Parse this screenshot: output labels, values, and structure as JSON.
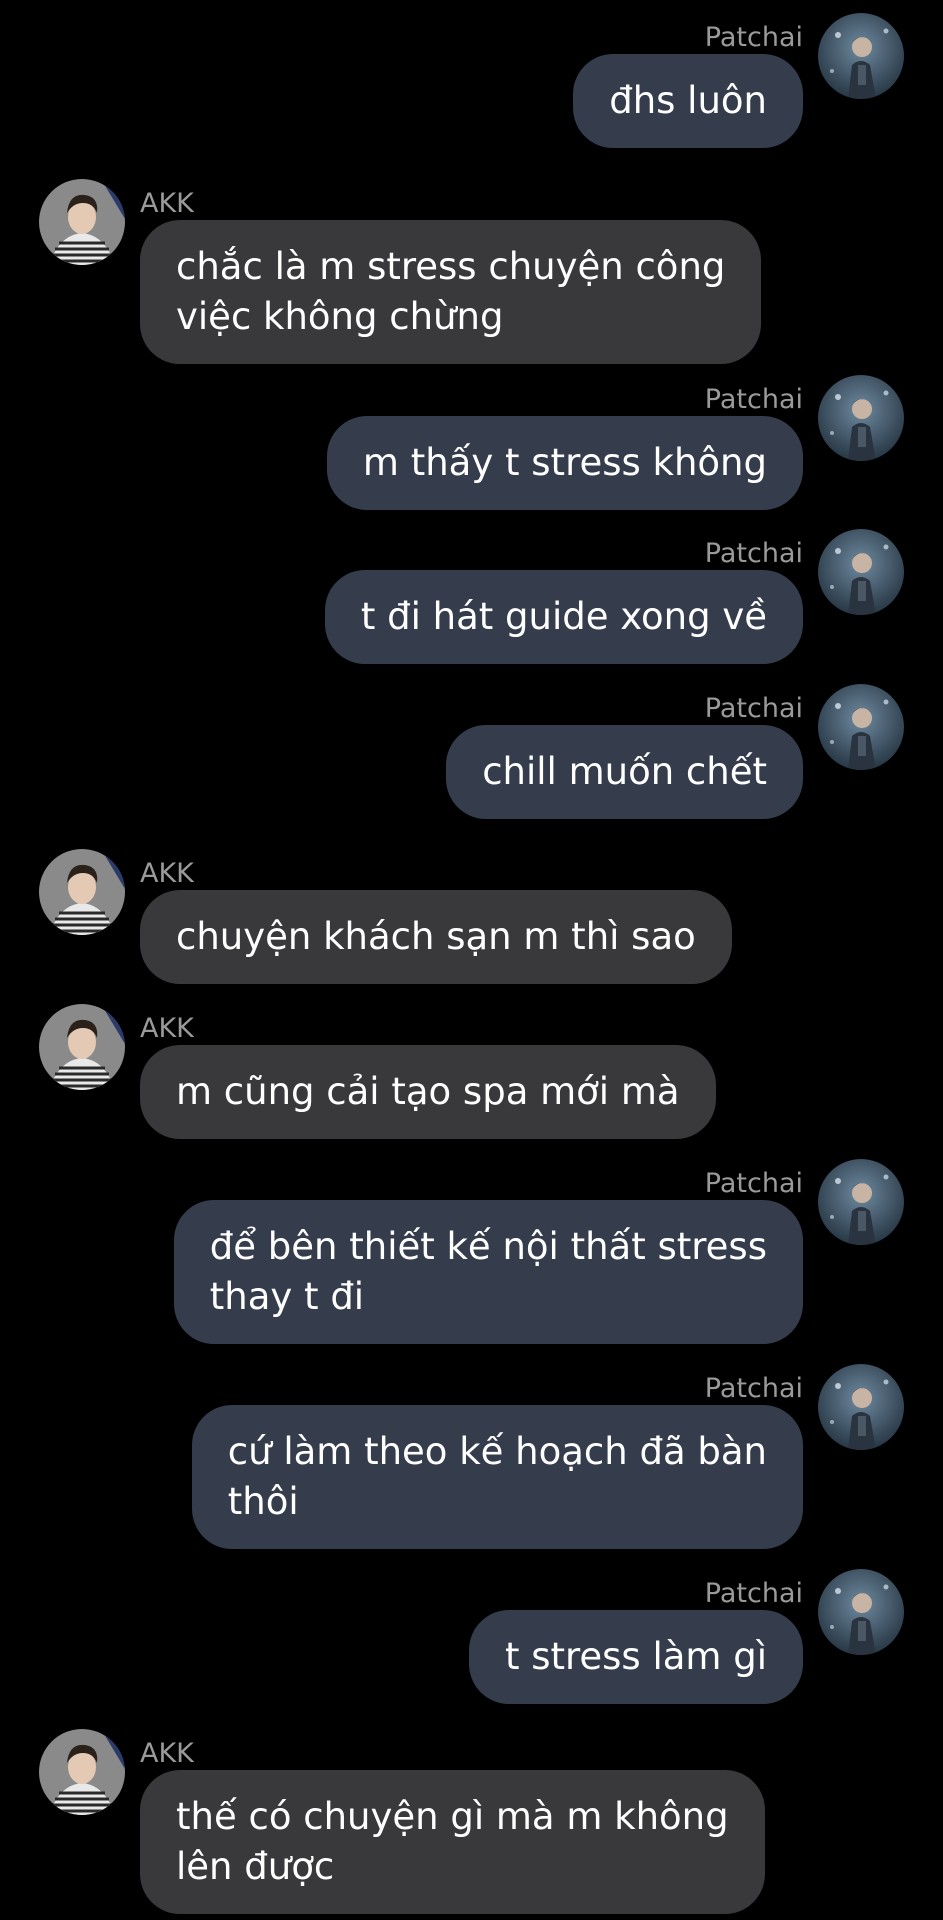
{
  "chat": {
    "messages": [
      {
        "side": "out",
        "sender": "Patchai",
        "lines": [
          "đhs luôn"
        ]
      },
      {
        "side": "in",
        "sender": "AKK",
        "lines": [
          "chắc là m stress chuyện công",
          "việc không chừng"
        ]
      },
      {
        "side": "out",
        "sender": "Patchai",
        "lines": [
          "m thấy t stress không"
        ]
      },
      {
        "side": "out",
        "sender": "Patchai",
        "lines": [
          "t đi hát guide xong về"
        ]
      },
      {
        "side": "out",
        "sender": "Patchai",
        "lines": [
          "chill muốn chết"
        ]
      },
      {
        "side": "in",
        "sender": "AKK",
        "lines": [
          "chuyện khách sạn m thì sao"
        ]
      },
      {
        "side": "in",
        "sender": "AKK",
        "lines": [
          "m cũng cải tạo spa mới mà"
        ]
      },
      {
        "side": "out",
        "sender": "Patchai",
        "lines": [
          "để bên thiết kế nội thất stress",
          "thay t đi"
        ]
      },
      {
        "side": "out",
        "sender": "Patchai",
        "lines": [
          "cứ làm theo kế hoạch đã bàn",
          "thôi"
        ]
      },
      {
        "side": "out",
        "sender": "Patchai",
        "lines": [
          "t stress làm gì"
        ]
      },
      {
        "side": "in",
        "sender": "AKK",
        "lines": [
          "thế có chuyện gì mà m không",
          "lên được"
        ]
      }
    ]
  },
  "colors": {
    "background": "#000000",
    "outgoing_bubble": "#353d4d",
    "incoming_bubble": "#39393c",
    "sender_name": "#9a9a9a",
    "message_text": "#ffffff"
  }
}
